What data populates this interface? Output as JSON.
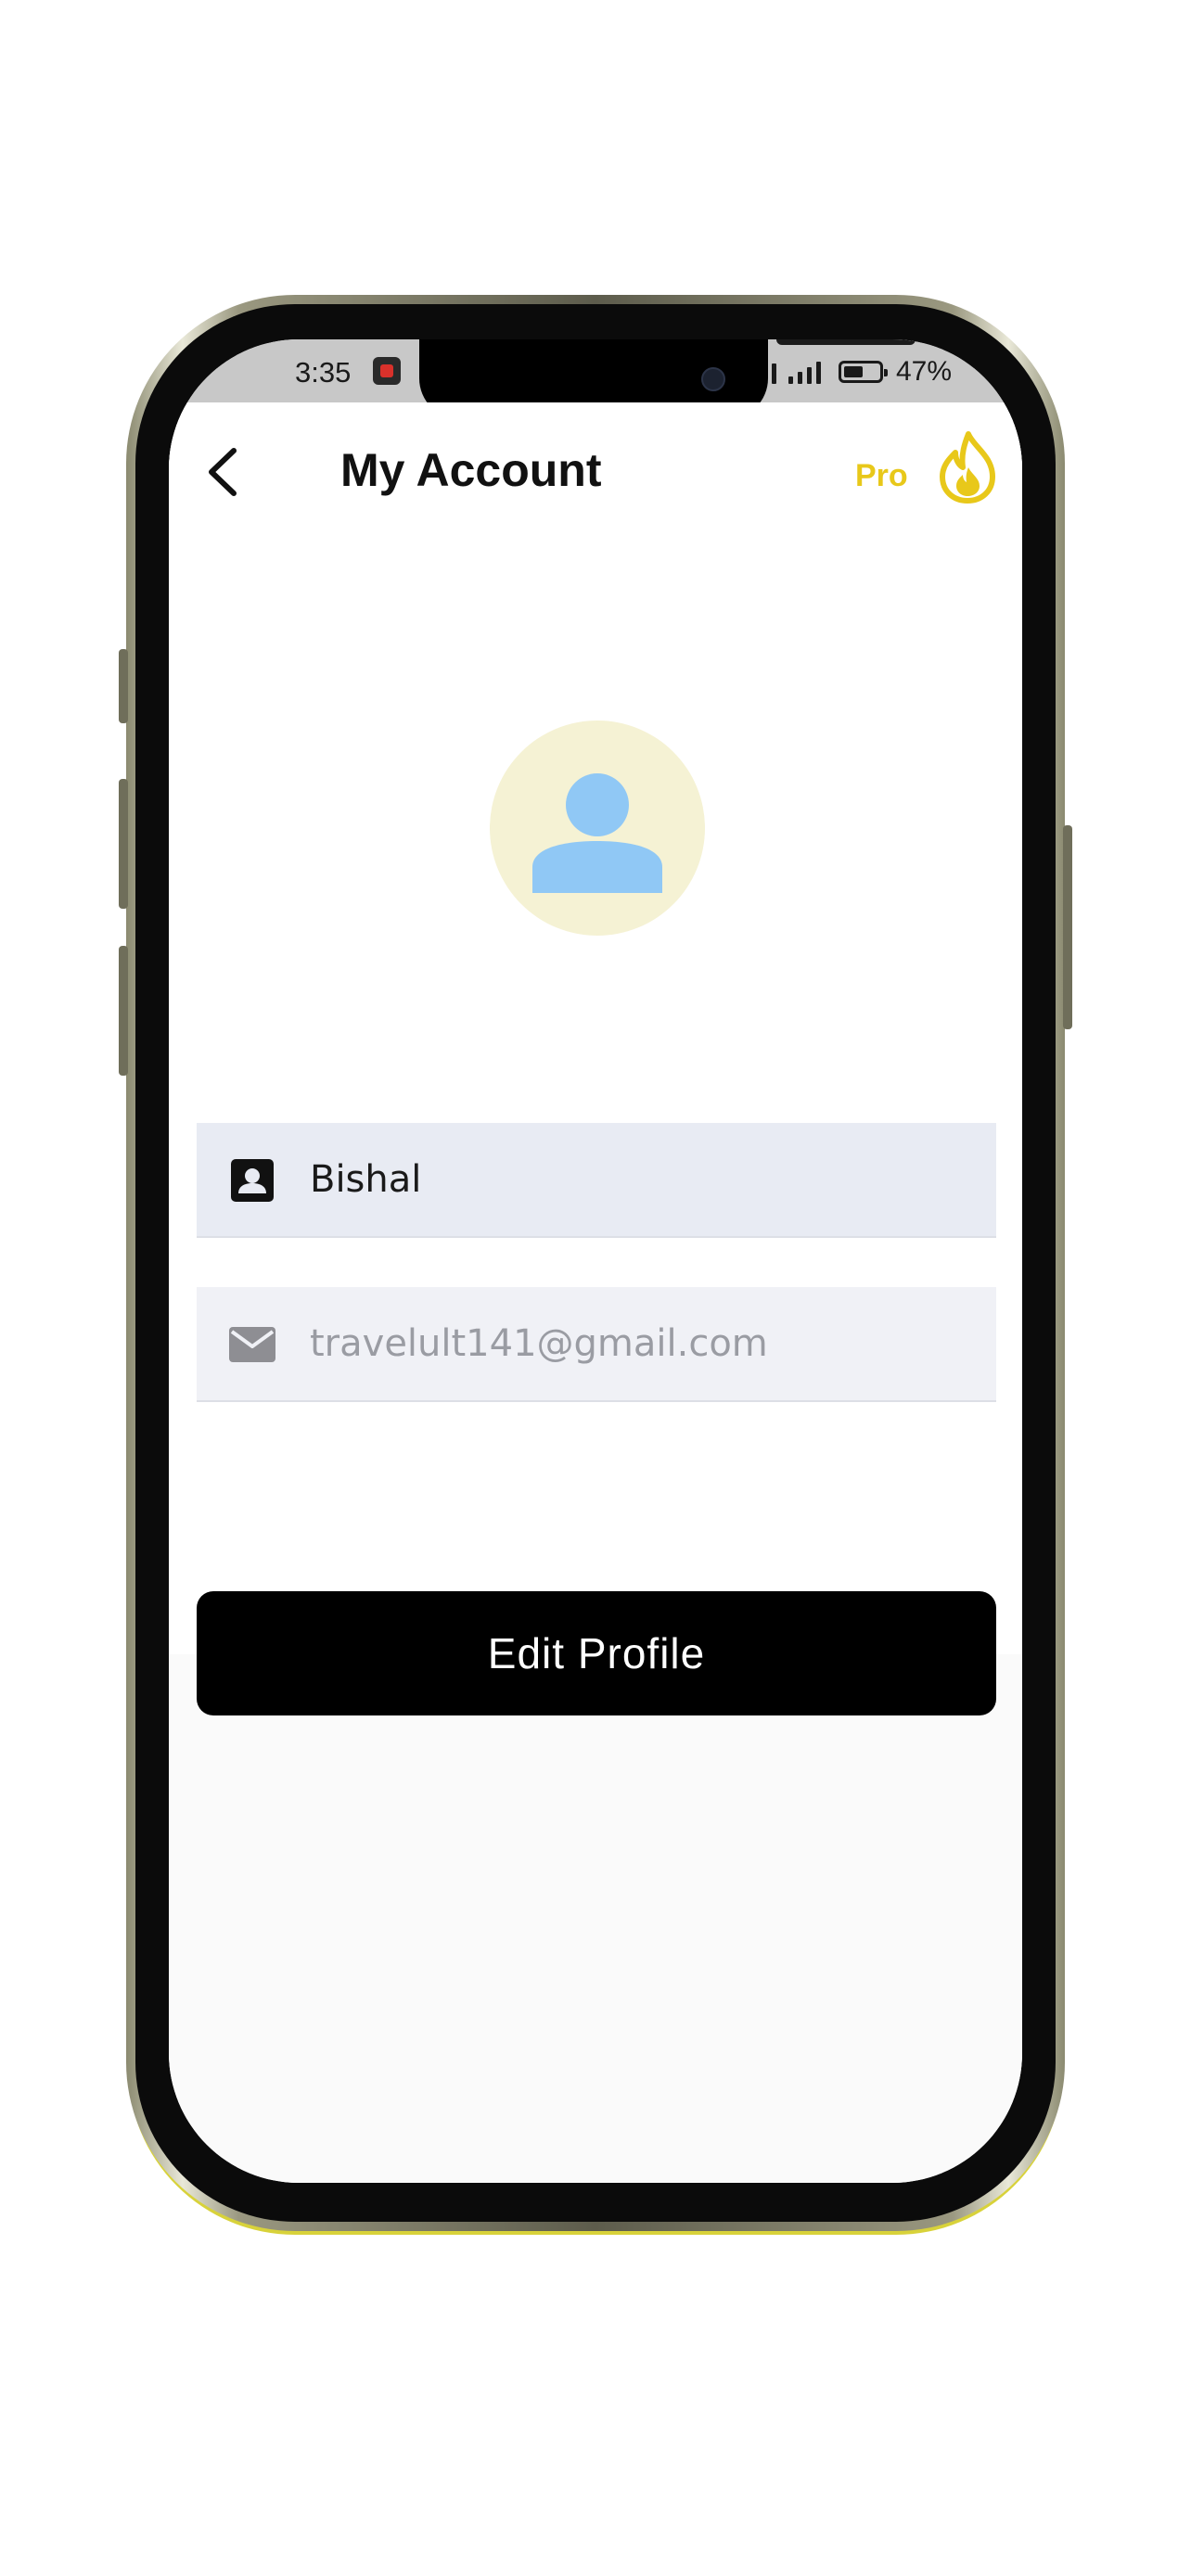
{
  "status_bar": {
    "time": "3:35",
    "battery_percent": "47%",
    "signal_bars": 4
  },
  "header": {
    "back_icon": "chevron-left-icon",
    "title": "My Account",
    "pro_label": "Pro",
    "pro_icon": "flame-icon"
  },
  "profile": {
    "avatar_icon": "person-icon"
  },
  "fields": {
    "name": {
      "icon": "contact-card-icon",
      "value": "Bishal"
    },
    "email": {
      "icon": "mail-icon",
      "value": "travelult141@gmail.com"
    }
  },
  "actions": {
    "edit_profile_label": "Edit Profile"
  },
  "colors": {
    "accent": "#e8c81a",
    "avatar_bg": "#f5f2d4",
    "avatar_icon": "#90c8f5",
    "button_bg": "#000000",
    "field_bg": "#e8ebf3"
  }
}
